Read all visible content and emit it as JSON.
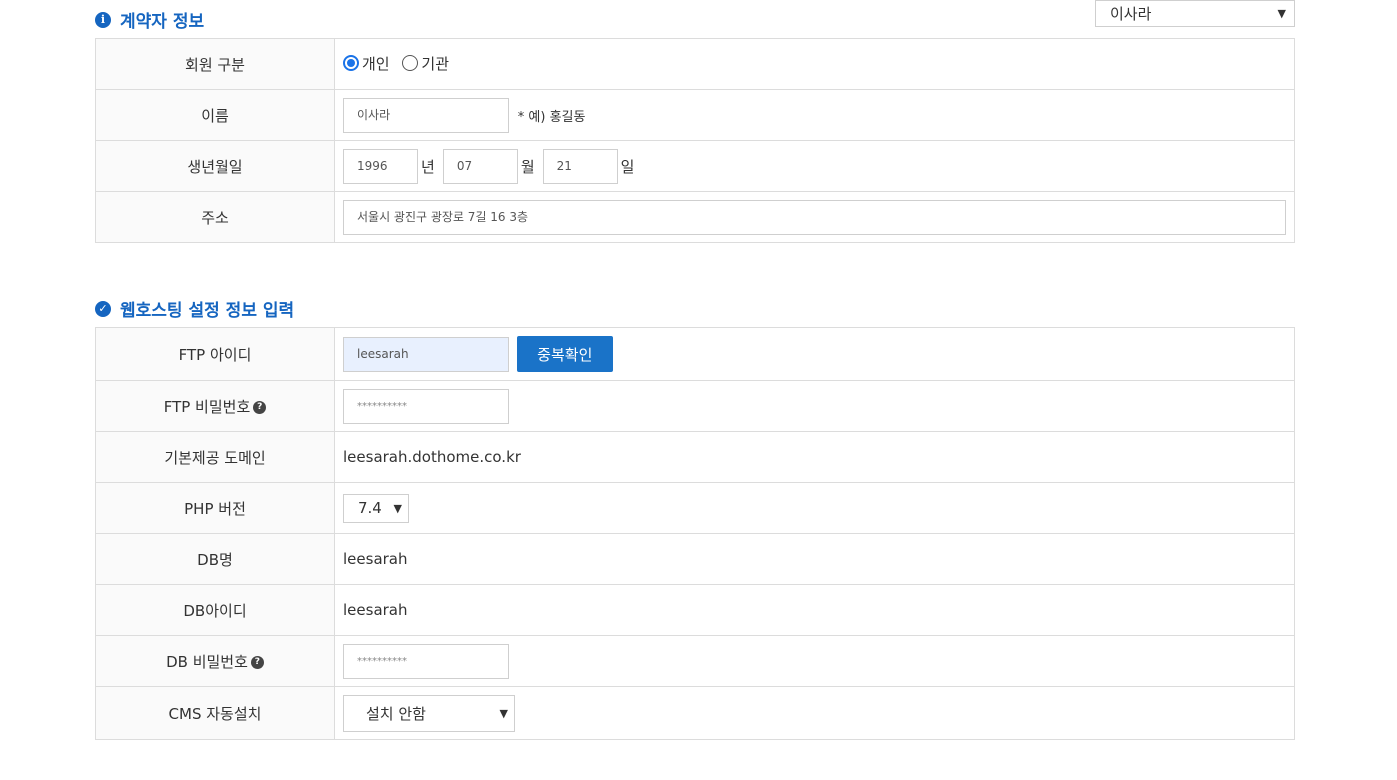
{
  "top_select": {
    "value": "이사라"
  },
  "contractor": {
    "title": "계약자 정보",
    "icon": "info-icon",
    "member_type": {
      "label": "회원 구분",
      "options": [
        "개인",
        "기관"
      ],
      "selected": "개인"
    },
    "name": {
      "label": "이름",
      "value": "이사라",
      "hint": "* 예) 홍길동"
    },
    "birth": {
      "label": "생년월일",
      "year": "1996",
      "year_unit": "년",
      "month": "07",
      "month_unit": "월",
      "day": "21",
      "day_unit": "일"
    },
    "address": {
      "label": "주소",
      "value": "서울시 광진구 광장로 7길 16 3층"
    }
  },
  "hosting": {
    "title": "웹호스팅 설정 정보 입력",
    "icon": "check-circle-icon",
    "ftp_id": {
      "label": "FTP 아이디",
      "value": "leesarah",
      "button": "중복확인"
    },
    "ftp_pw": {
      "label": "FTP 비밀번호",
      "value": "**********"
    },
    "domain": {
      "label": "기본제공 도메인",
      "value": "leesarah.dothome.co.kr"
    },
    "php": {
      "label": "PHP 버전",
      "value": "7.4"
    },
    "db_name": {
      "label": "DB명",
      "value": "leesarah"
    },
    "db_id": {
      "label": "DB아이디",
      "value": "leesarah"
    },
    "db_pw": {
      "label": "DB 비밀번호",
      "value": "**********"
    },
    "cms": {
      "label": "CMS 자동설치",
      "value": "설치 안함"
    }
  }
}
